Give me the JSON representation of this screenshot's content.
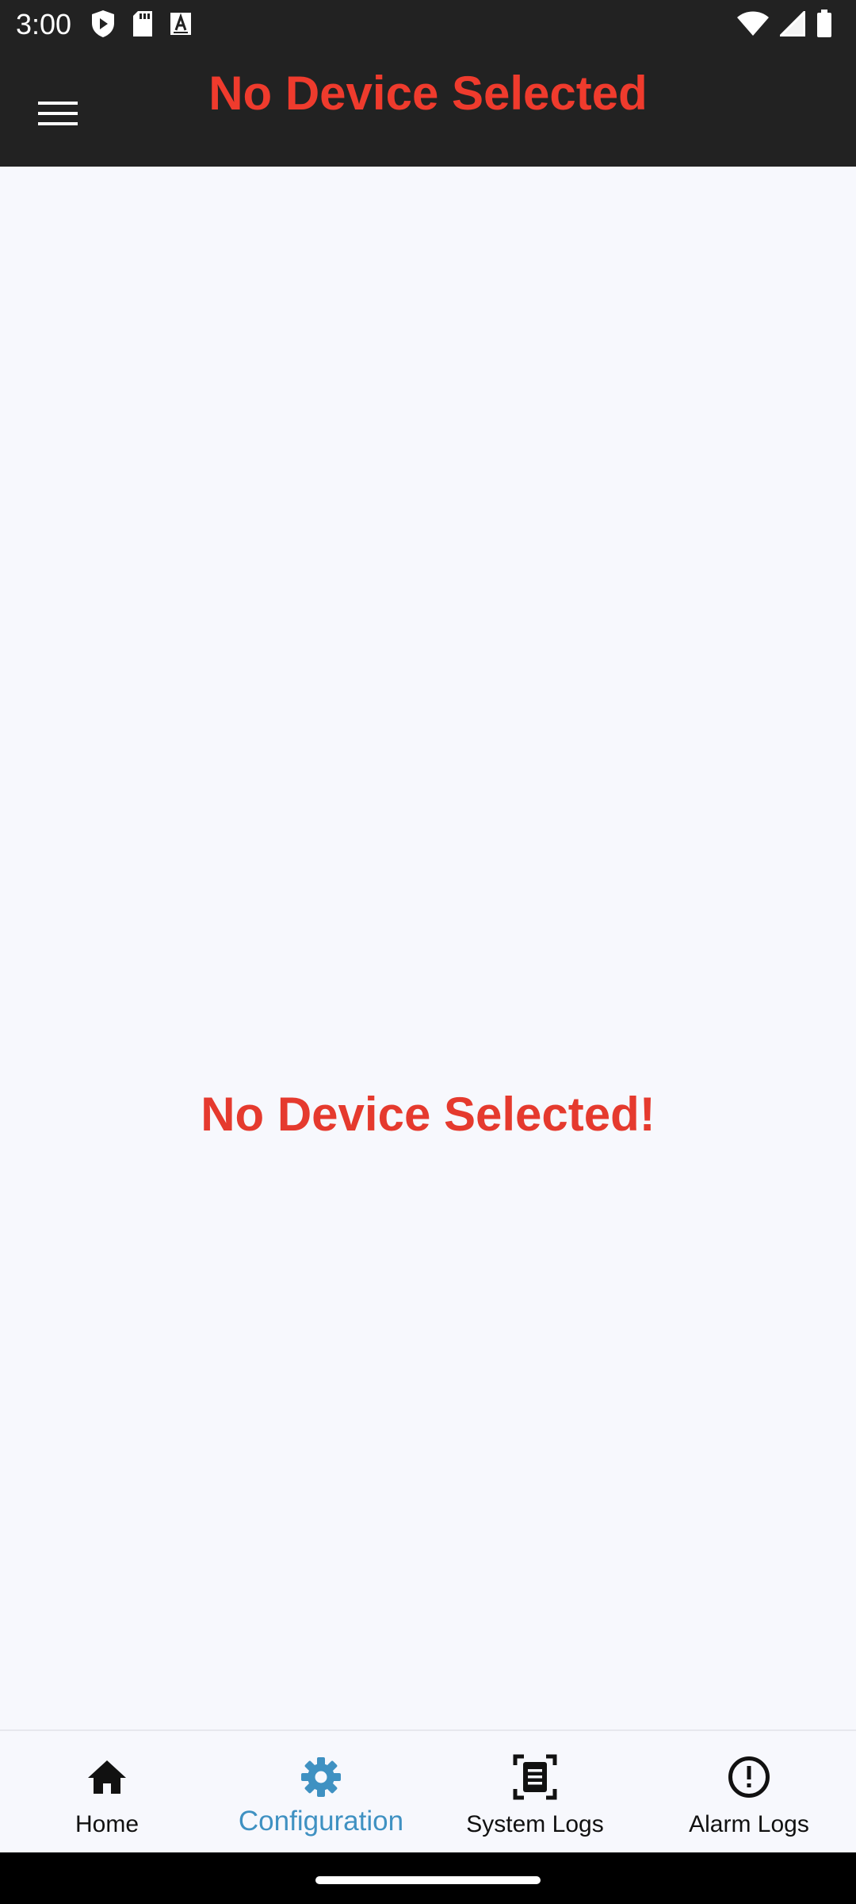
{
  "status_bar": {
    "time": "3:00",
    "left_icons": [
      "shield-play-icon",
      "sd-card-icon",
      "keyboard-a-icon"
    ],
    "right_icons": [
      "wifi-icon",
      "signal-icon",
      "battery-icon"
    ]
  },
  "app_bar": {
    "title": "No Device Selected",
    "menu_icon": "menu-icon",
    "background": "#222222",
    "title_color": "#ef3b2d"
  },
  "main": {
    "empty_message": "No Device Selected!",
    "message_color": "#e53a2e"
  },
  "bottom_nav": {
    "active_color": "#3f91c2",
    "items": [
      {
        "label": "Home",
        "icon": "home-icon",
        "active": false
      },
      {
        "label": "Configuration",
        "icon": "gear-icon",
        "active": true
      },
      {
        "label": "System Logs",
        "icon": "document-scan-icon",
        "active": false
      },
      {
        "label": "Alarm Logs",
        "icon": "alert-circle-icon",
        "active": false
      }
    ]
  }
}
